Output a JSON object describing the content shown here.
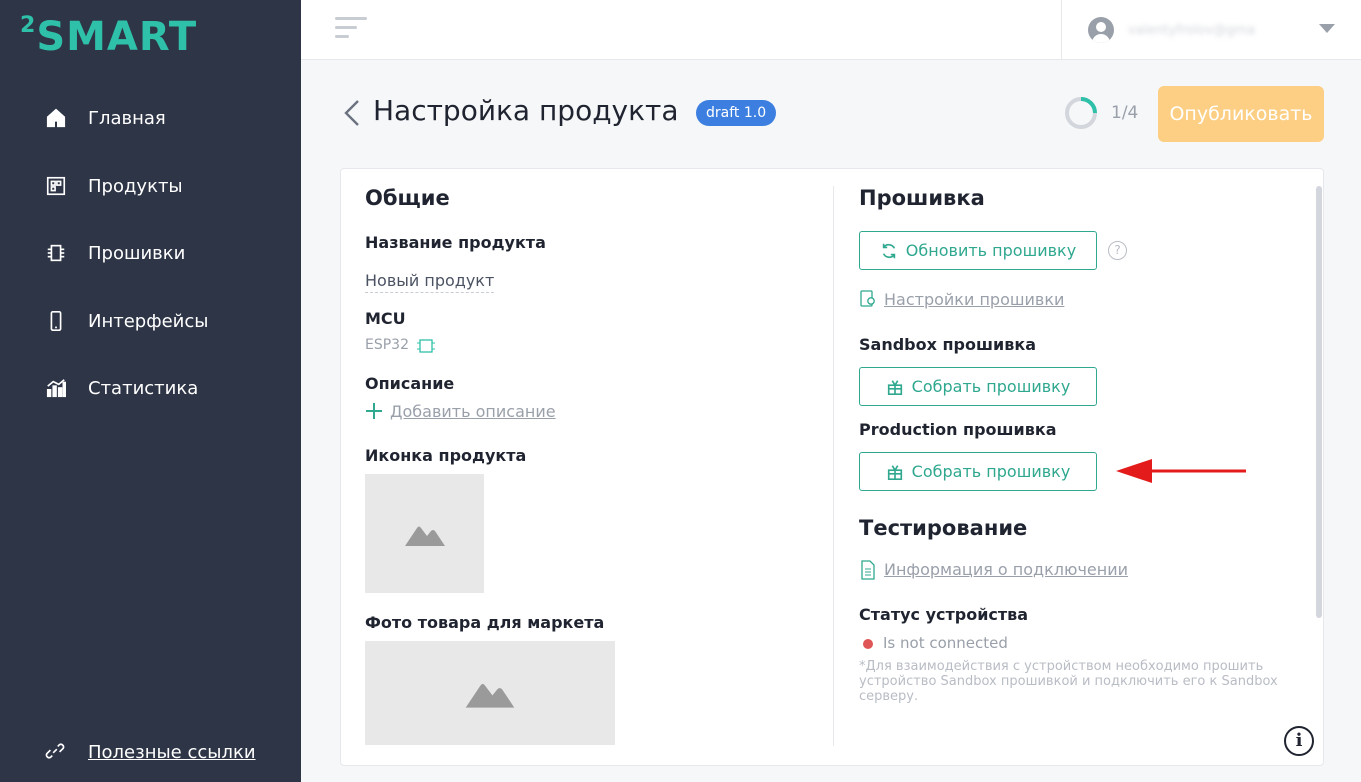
{
  "app": {
    "logo_text": "SMART",
    "logo_sup": "2"
  },
  "sidebar": {
    "items": [
      {
        "label": "Главная",
        "icon": "home-icon"
      },
      {
        "label": "Продукты",
        "icon": "products-icon"
      },
      {
        "label": "Прошивки",
        "icon": "chip-icon"
      },
      {
        "label": "Интерфейсы",
        "icon": "phone-icon"
      },
      {
        "label": "Статистика",
        "icon": "stats-icon"
      }
    ],
    "bottom_link": "Полезные ссылки"
  },
  "header": {
    "user_email": "valentyfrolov@gma",
    "page_title": "Настройка продукта",
    "draft_badge": "draft 1.0",
    "progress_text": "1/4",
    "progress_value": 0.25,
    "publish_label": "Опубликовать"
  },
  "general": {
    "title": "Общие",
    "product_name_label": "Название продукта",
    "product_name_value": "Новый продукт",
    "mcu_label": "MCU",
    "mcu_value": "ESP32",
    "description_label": "Описание",
    "add_description": "Добавить описание",
    "icon_label": "Иконка продукта",
    "photo_label": "Фото товара для маркета"
  },
  "firmware": {
    "title": "Прошивка",
    "update_button": "Обновить прошивку",
    "settings_link": "Настройки прошивки",
    "sandbox_label": "Sandbox прошивка",
    "sandbox_button": "Собрать прошивку",
    "production_label": "Production прошивка",
    "production_button": "Собрать прошивку"
  },
  "testing": {
    "title": "Тестирование",
    "connection_link": "Информация о подключении",
    "device_status_label": "Статус устройства",
    "device_status_value": "Is not connected",
    "note": "*Для взаимодействия с устройством необходимо прошить устройство Sandbox прошивкой и подключить его к Sandbox серверу."
  },
  "colors": {
    "sidebar_bg": "#2e3547",
    "accent": "#2fc0a9",
    "teal": "#2fa88f",
    "publish": "#fccf85",
    "badge": "#3c7fe0",
    "status_red": "#e05555",
    "arrow": "#e31b1b"
  }
}
